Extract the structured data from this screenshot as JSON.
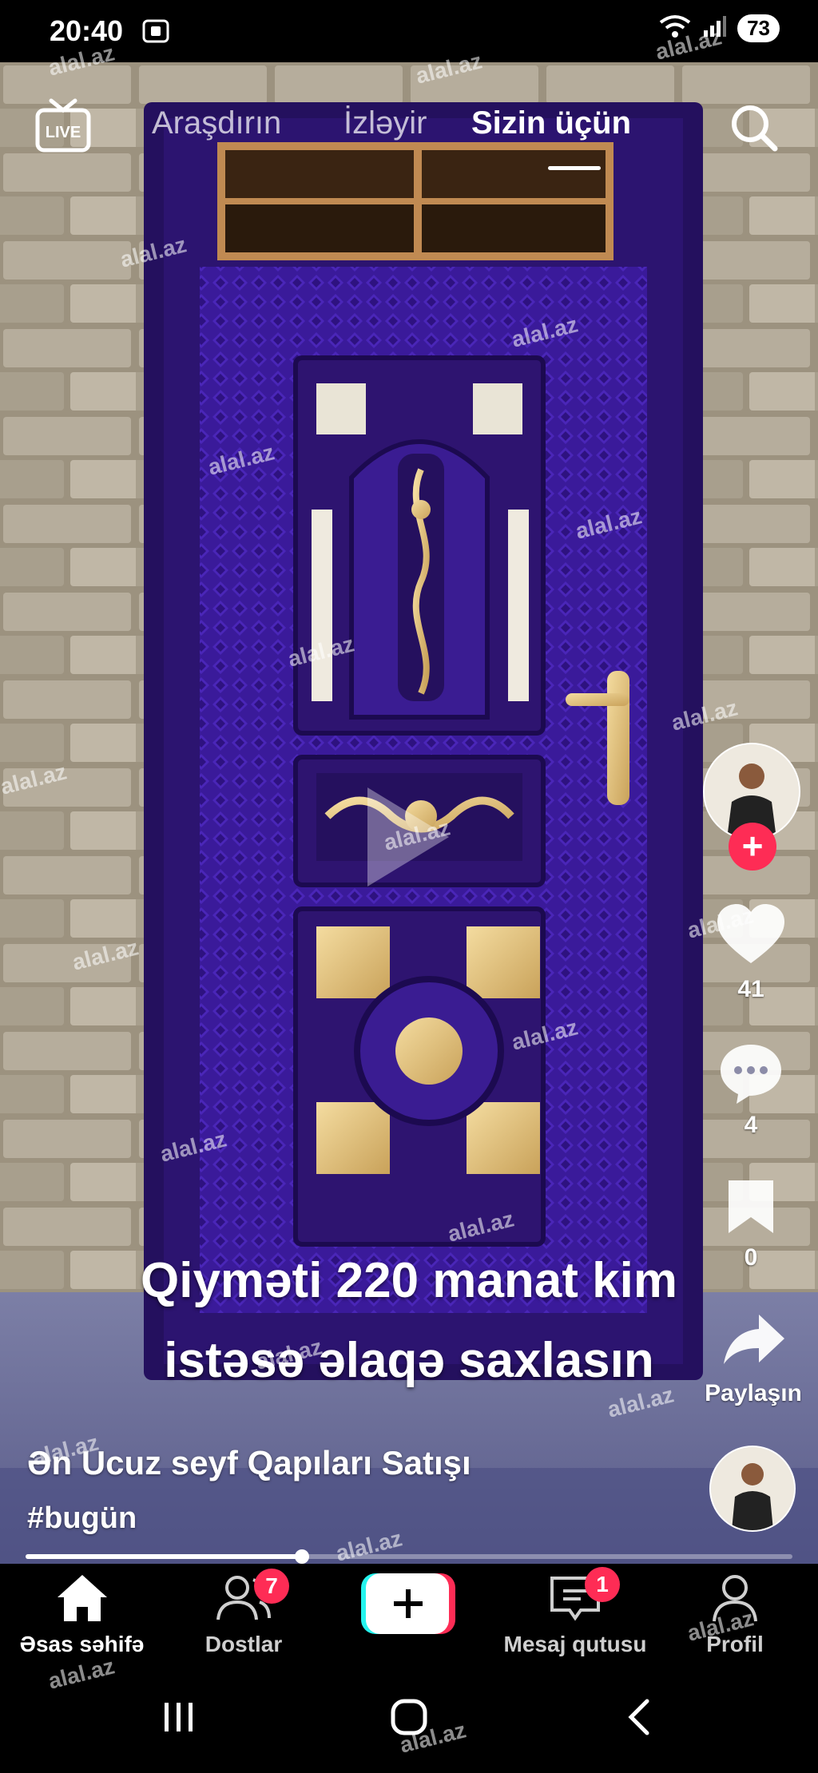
{
  "status_bar": {
    "time": "20:40",
    "battery": "73"
  },
  "top_nav": {
    "live_label": "LIVE",
    "tabs": [
      {
        "label": "Araşdırın"
      },
      {
        "label": "İzləyir"
      },
      {
        "label": "Sizin üçün",
        "active": true
      }
    ]
  },
  "video": {
    "caption_line1": "Qiyməti 220 manat  kim",
    "caption_line2": "istəsə əlaqə saxlasın",
    "author": "Ən Ucuz seyf Qapıları Satışı",
    "hashtag": "#bugün",
    "progress": 0.36
  },
  "actions": {
    "likes": "41",
    "comments": "4",
    "bookmarks": "0",
    "share_label": "Paylaşın"
  },
  "bottom_nav": {
    "home": "Əsas səhifə",
    "friends": "Dostlar",
    "friends_badge": "7",
    "inbox": "Mesaj qutusu",
    "inbox_badge": "1",
    "profile": "Profil"
  },
  "watermark": "alal.az",
  "colors": {
    "accent": "#fe2c55",
    "door": "#3a1a9a",
    "background": "#000000"
  }
}
